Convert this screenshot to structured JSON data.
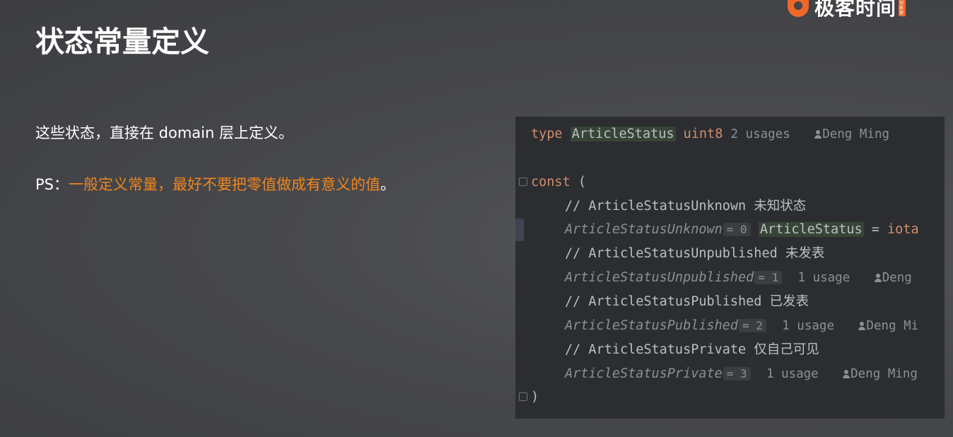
{
  "brand": {
    "name": "极客时间",
    "tag": "训练营"
  },
  "slide": {
    "title": "状态常量定义",
    "paragraph1": "这些状态，直接在 domain 层上定义。",
    "ps_prefix": "PS：",
    "ps_highlight": "一般定义常量，最好不要把零值做成有意义的值",
    "ps_suffix": "。"
  },
  "code": {
    "line1": {
      "kw": "type",
      "name": "ArticleStatus",
      "type": "uint8",
      "usages": "2 usages",
      "author": "Deng Ming"
    },
    "line2": {
      "kw": "const",
      "open": " ("
    },
    "line3": {
      "comment": "// ArticleStatusUnknown 未知状态"
    },
    "line4": {
      "name": "ArticleStatusUnknown",
      "hint": "= 0",
      "type": "ArticleStatus",
      "eq": " = ",
      "value": "iota"
    },
    "line5": {
      "comment": "// ArticleStatusUnpublished 未发表"
    },
    "line6": {
      "name": "ArticleStatusUnpublished",
      "hint": "= 1",
      "usages": "1 usage",
      "author": "Deng"
    },
    "line7": {
      "comment": "// ArticleStatusPublished 已发表"
    },
    "line8": {
      "name": "ArticleStatusPublished",
      "hint": "= 2",
      "usages": "1 usage",
      "author": "Deng Mi"
    },
    "line9": {
      "comment": "// ArticleStatusPrivate 仅自己可见"
    },
    "line10": {
      "name": "ArticleStatusPrivate",
      "hint": "= 3",
      "usages": "1 usage",
      "author": "Deng Ming"
    },
    "line11": {
      "close": ")"
    }
  },
  "colors": {
    "accent": "#f0851e",
    "brand": "#f0672a",
    "code_bg": "#2b2d30",
    "keyword": "#cf8e6d"
  }
}
